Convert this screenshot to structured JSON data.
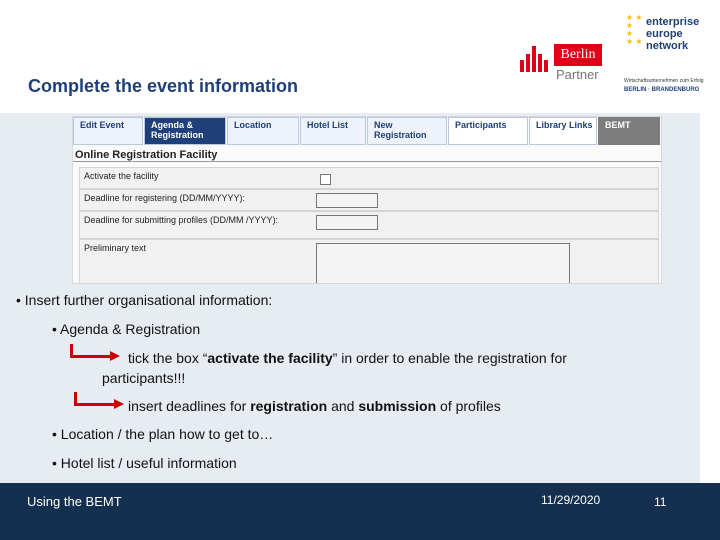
{
  "slide": {
    "title": "Complete the event information"
  },
  "logos": {
    "berlin": {
      "word": "Berlin",
      "sub": "Partner"
    },
    "een": {
      "lines": [
        "enterprise",
        "europe",
        "network"
      ],
      "tagline": "Wirtschaftsunternehmen zum Erfolg",
      "region": "BERLIN · BRANDENBURG"
    }
  },
  "screenshot": {
    "tabs": [
      "Edit Event",
      "Agenda & Registration",
      "Location",
      "Hotel List",
      "New Registration",
      "Participants",
      "Library Links",
      "BEMT"
    ],
    "active_tab": 1,
    "form_title": "Online Registration Facility",
    "rows": [
      "Activate the facility",
      "Deadline for registering (DD/MM/YYYY):",
      "Deadline for submitting profiles (DD/MM /YYYY):",
      "Preliminary text"
    ]
  },
  "bullets": {
    "b1": "Insert further organisational information:",
    "b2": "Agenda & Registration",
    "arrow1_pre": "tick the box “",
    "arrow1_bold": "activate the facility",
    "arrow1_post": "” in order to enable the registration for",
    "arrow1_cont": "participants!!!",
    "arrow2_pre": "insert deadlines for ",
    "arrow2_b1": "registration",
    "arrow2_mid": " and ",
    "arrow2_b2": "submission",
    "arrow2_post": " of profiles",
    "b3": "Location / the plan how to get to…",
    "b4": "Hotel list / useful information"
  },
  "footer": {
    "left": "Using the BEMT",
    "date": "11/29/2020",
    "page": "11"
  },
  "colors": {
    "title": "#1f3f78",
    "footer_bg": "#15304f",
    "arrow": "#cc0000",
    "logo_red": "#e1001a",
    "logo_star": "#f2c200"
  }
}
